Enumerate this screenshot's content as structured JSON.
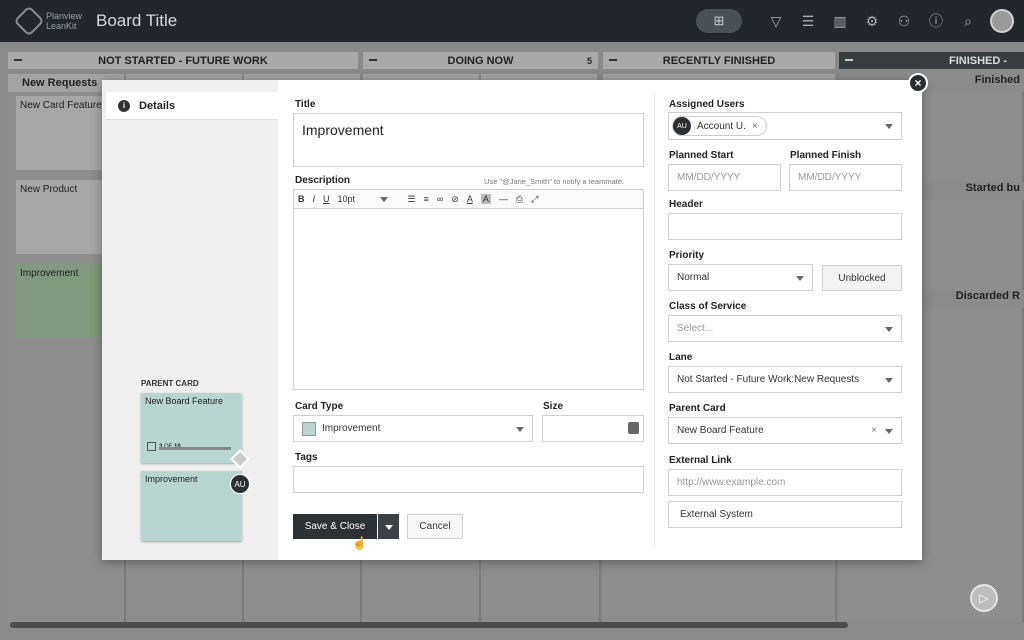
{
  "topbar": {
    "logo_line1": "Planview",
    "logo_line2": "LeanKit",
    "board_title": "Board Title"
  },
  "board": {
    "columns": [
      "NOT STARTED - FUTURE WORK",
      "DOING NOW",
      "RECENTLY FINISHED",
      "FINISHED -"
    ],
    "doing_now_count": "5",
    "lanes": [
      "New Requests",
      "Finished",
      "Started bu",
      "Discarded R"
    ],
    "cards": [
      "New Card Feature",
      "New Product",
      "Improvement"
    ]
  },
  "modal": {
    "tab_details": "Details",
    "parent_card_label": "PARENT CARD",
    "parent_card_title": "New Board Feature",
    "parent_progress_done": "3",
    "parent_progress_of": "OF",
    "parent_progress_total": "10",
    "child_card_title": "Improvement",
    "child_avatar": "AU",
    "title_label": "Title",
    "title_value": "Improvement",
    "description_label": "Description",
    "description_hint": "Use \"@Jane_Smith\" to notify a teammate.",
    "toolbar": {
      "bold": "B",
      "italic": "I",
      "underline": "U",
      "font_size": "10pt",
      "text_color": "A",
      "highlight": "A"
    },
    "card_type_label": "Card Type",
    "card_type_value": "Improvement",
    "size_label": "Size",
    "tags_label": "Tags",
    "save_label": "Save & Close",
    "cancel_label": "Cancel",
    "assigned_users_label": "Assigned Users",
    "assigned_user_initials": "AU",
    "assigned_user_name": "Account U.",
    "planned_start_label": "Planned Start",
    "planned_start_placeholder": "MM/DD/YYYY",
    "planned_finish_label": "Planned Finish",
    "planned_finish_placeholder": "MM/DD/YYYY",
    "header_label": "Header",
    "priority_label": "Priority",
    "priority_value": "Normal",
    "unblocked_label": "Unblocked",
    "class_of_service_label": "Class of Service",
    "class_of_service_placeholder": "Select...",
    "lane_label": "Lane",
    "lane_value": "Not Started - Future Work:New Requests",
    "parent_card_field_label": "Parent Card",
    "parent_card_field_value": "New Board Feature",
    "external_link_label": "External Link",
    "external_link_placeholder": "http://www.example.com",
    "external_system_placeholder": "External System"
  }
}
